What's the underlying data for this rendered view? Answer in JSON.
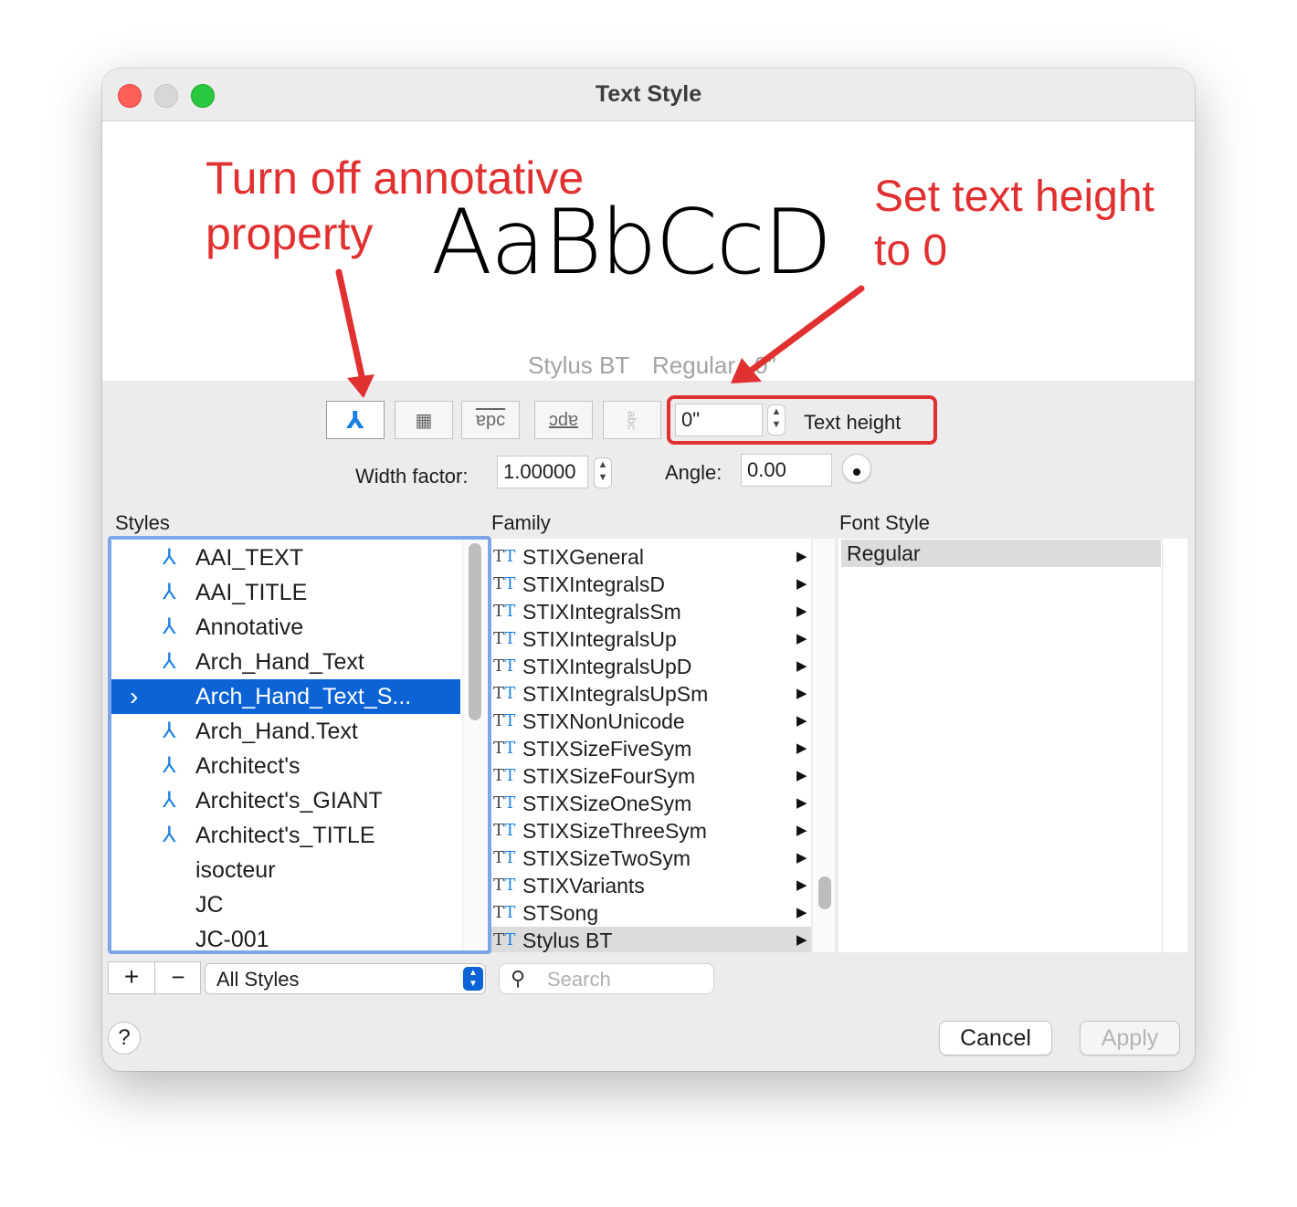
{
  "window": {
    "title": "Text Style"
  },
  "preview": {
    "sample_text": "AaBbCcD",
    "font_name": "Stylus BT",
    "font_style": "Regular",
    "height_suffix": "0\""
  },
  "annotations": {
    "annotative_note_line1": "Turn off annotative",
    "annotative_note_line2": "property",
    "height_note_line1": "Set text height",
    "height_note_line2": "to 0"
  },
  "toolbar": {
    "buttons": [
      {
        "name": "annotative",
        "glyph": "⅄"
      },
      {
        "name": "match",
        "glyph": "▦"
      },
      {
        "name": "upside-down",
        "glyph": "ɐpc"
      },
      {
        "name": "backwards",
        "glyph": "ɔdɐ"
      },
      {
        "name": "vertical",
        "glyph": "abc"
      }
    ],
    "text_height_value": "0\"",
    "text_height_label": "Text height",
    "width_factor_label": "Width factor:",
    "width_factor_value": "1.00000",
    "angle_label": "Angle:",
    "angle_value": "0.00"
  },
  "styles": {
    "header": "Styles",
    "items": [
      {
        "label": "AAI_TEXT",
        "annotative": true
      },
      {
        "label": "AAI_TITLE",
        "annotative": true
      },
      {
        "label": "Annotative",
        "annotative": true
      },
      {
        "label": "Arch_Hand_Text",
        "annotative": true
      },
      {
        "label": "Arch_Hand_Text_S...",
        "annotative": false,
        "selected": true
      },
      {
        "label": "Arch_Hand.Text",
        "annotative": true
      },
      {
        "label": "Architect's",
        "annotative": true
      },
      {
        "label": "Architect's_GIANT",
        "annotative": true
      },
      {
        "label": "Architect's_TITLE",
        "annotative": true
      },
      {
        "label": "isocteur",
        "annotative": false
      },
      {
        "label": "JC",
        "annotative": false
      },
      {
        "label": "JC-001",
        "annotative": false
      }
    ],
    "add_label": "+",
    "remove_label": "−",
    "filter_value": "All Styles"
  },
  "family": {
    "header": "Family",
    "items": [
      "STIXGeneral",
      "STIXIntegralsD",
      "STIXIntegralsSm",
      "STIXIntegralsUp",
      "STIXIntegralsUpD",
      "STIXIntegralsUpSm",
      "STIXNonUnicode",
      "STIXSizeFiveSym",
      "STIXSizeFourSym",
      "STIXSizeOneSym",
      "STIXSizeThreeSym",
      "STIXSizeTwoSym",
      "STIXVariants",
      "STSong",
      "Stylus BT"
    ],
    "selected": "Stylus BT",
    "search_placeholder": "Search"
  },
  "font_style": {
    "header": "Font Style",
    "items": [
      "Regular"
    ]
  },
  "footer": {
    "help_label": "?",
    "cancel_label": "Cancel",
    "apply_label": "Apply"
  },
  "colors": {
    "annotation_red": "#e0302f",
    "selection_blue": "#0b63d6",
    "annotative_icon_blue": "#1a7fe0"
  }
}
